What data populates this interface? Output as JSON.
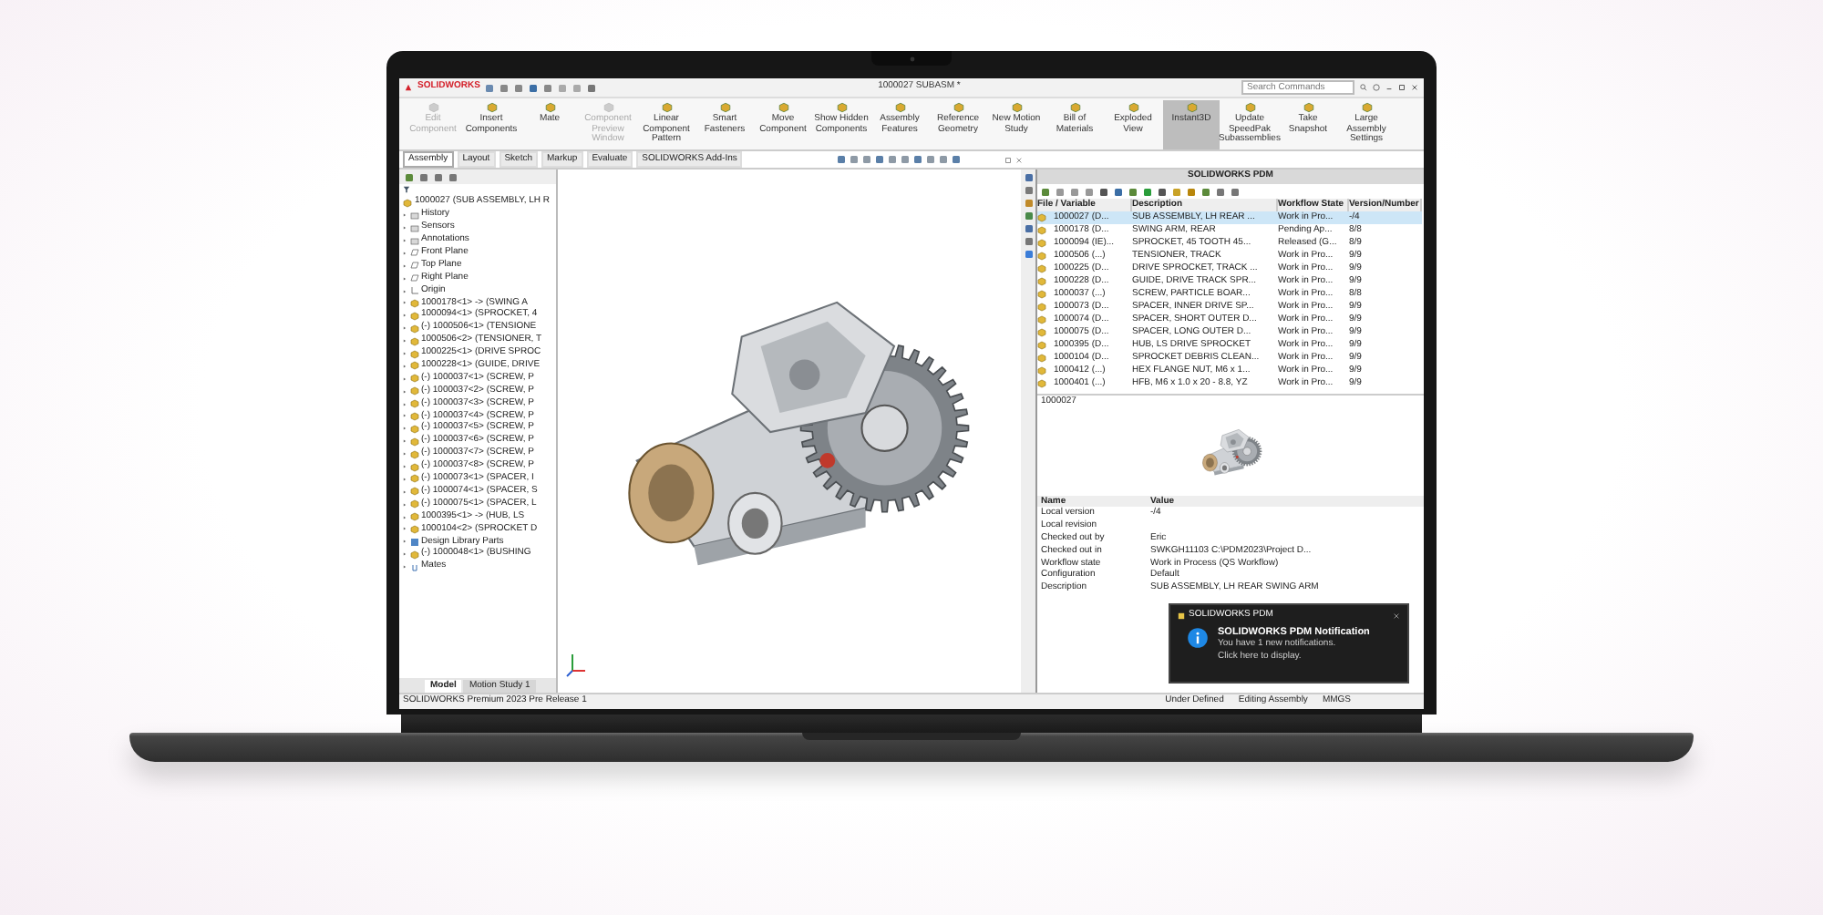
{
  "app": {
    "logo": "SOLIDWORKS",
    "title": "1000027 SUBASM *",
    "search": {
      "placeholder": "Search Commands"
    }
  },
  "ribbon": [
    {
      "label": "Edit Component",
      "disabled": true,
      "selected": false
    },
    {
      "label": "Insert Components",
      "disabled": false,
      "selected": false
    },
    {
      "label": "Mate",
      "disabled": false,
      "selected": false
    },
    {
      "label": "Component Preview Window",
      "disabled": true,
      "selected": false
    },
    {
      "label": "Linear Component Pattern",
      "disabled": false,
      "selected": false
    },
    {
      "label": "Smart Fasteners",
      "disabled": false,
      "selected": false
    },
    {
      "label": "Move Component",
      "disabled": false,
      "selected": false
    },
    {
      "label": "Show Hidden Components",
      "disabled": false,
      "selected": false
    },
    {
      "label": "Assembly Features",
      "disabled": false,
      "selected": false
    },
    {
      "label": "Reference Geometry",
      "disabled": false,
      "selected": false
    },
    {
      "label": "New Motion Study",
      "disabled": false,
      "selected": false
    },
    {
      "label": "Bill of Materials",
      "disabled": false,
      "selected": false
    },
    {
      "label": "Exploded View",
      "disabled": false,
      "selected": false
    },
    {
      "label": "Instant3D",
      "disabled": false,
      "selected": true
    },
    {
      "label": "Update SpeedPak Subassemblies",
      "disabled": false,
      "selected": false
    },
    {
      "label": "Take Snapshot",
      "disabled": false,
      "selected": false
    },
    {
      "label": "Large Assembly Settings",
      "disabled": false,
      "selected": false
    }
  ],
  "tabs": [
    {
      "label": "Assembly",
      "selected": true
    },
    {
      "label": "Layout",
      "selected": false
    },
    {
      "label": "Sketch",
      "selected": false
    },
    {
      "label": "Markup",
      "selected": false
    },
    {
      "label": "Evaluate",
      "selected": false
    },
    {
      "label": "SOLIDWORKS Add-Ins",
      "selected": false
    }
  ],
  "tree": {
    "root": "1000027 (SUB ASSEMBLY, LH R",
    "items": [
      {
        "kind": "folder",
        "label": "History"
      },
      {
        "kind": "folder",
        "label": "Sensors"
      },
      {
        "kind": "folder",
        "label": "Annotations"
      },
      {
        "kind": "plane",
        "label": "Front Plane"
      },
      {
        "kind": "plane",
        "label": "Top Plane"
      },
      {
        "kind": "plane",
        "label": "Right Plane"
      },
      {
        "kind": "origin",
        "label": "Origin"
      },
      {
        "kind": "component",
        "label": "1000178<1> -> (SWING A"
      },
      {
        "kind": "component",
        "label": "1000094<1> (SPROCKET, 4"
      },
      {
        "kind": "component",
        "label": "(-) 1000506<1> (TENSIONE"
      },
      {
        "kind": "component",
        "label": "1000506<2> (TENSIONER, T"
      },
      {
        "kind": "component",
        "label": "1000225<1> (DRIVE SPROC"
      },
      {
        "kind": "component",
        "label": "1000228<1> (GUIDE, DRIVE"
      },
      {
        "kind": "component",
        "label": "(-) 1000037<1> (SCREW, P"
      },
      {
        "kind": "component",
        "label": "(-) 1000037<2> (SCREW, P"
      },
      {
        "kind": "component",
        "label": "(-) 1000037<3> (SCREW, P"
      },
      {
        "kind": "component",
        "label": "(-) 1000037<4> (SCREW, P"
      },
      {
        "kind": "component",
        "label": "(-) 1000037<5> (SCREW, P"
      },
      {
        "kind": "component",
        "label": "(-) 1000037<6> (SCREW, P"
      },
      {
        "kind": "component",
        "label": "(-) 1000037<7> (SCREW, P"
      },
      {
        "kind": "component",
        "label": "(-) 1000037<8> (SCREW, P"
      },
      {
        "kind": "component",
        "label": "(-) 1000073<1> (SPACER, I"
      },
      {
        "kind": "component",
        "label": "(-) 1000074<1> (SPACER, S"
      },
      {
        "kind": "component",
        "label": "(-) 1000075<1> (SPACER, L"
      },
      {
        "kind": "component",
        "label": "1000395<1> -> (HUB, LS"
      },
      {
        "kind": "component",
        "label": "1000104<2> (SPROCKET D"
      },
      {
        "kind": "library",
        "label": "Design Library Parts"
      },
      {
        "kind": "component",
        "label": "(-) 1000048<1> (BUSHING"
      },
      {
        "kind": "mates",
        "label": "Mates"
      }
    ]
  },
  "bottom_tabs": [
    {
      "label": "Model",
      "selected": true
    },
    {
      "label": "Motion Study 1",
      "selected": false
    }
  ],
  "pdm": {
    "title": "SOLIDWORKS PDM",
    "columns": [
      "File / Variable",
      "Description",
      "Workflow State",
      "Version/Number"
    ],
    "rows": [
      {
        "file": "1000027 (D...",
        "description": "SUB ASSEMBLY, LH REAR ...",
        "state": "Work in Pro...",
        "version": "-/4",
        "selected": true
      },
      {
        "file": "1000178 (D...",
        "description": "SWING ARM, REAR",
        "state": "Pending Ap...",
        "version": "8/8",
        "selected": false
      },
      {
        "file": "1000094 (IE)...",
        "description": "SPROCKET, 45 TOOTH 45...",
        "state": "Released (G...",
        "version": "8/9",
        "selected": false
      },
      {
        "file": "1000506 (...)",
        "description": "TENSIONER, TRACK",
        "state": "Work in Pro...",
        "version": "9/9",
        "selected": false
      },
      {
        "file": "1000225 (D...",
        "description": "DRIVE SPROCKET, TRACK ...",
        "state": "Work in Pro...",
        "version": "9/9",
        "selected": false
      },
      {
        "file": "1000228 (D...",
        "description": "GUIDE, DRIVE TRACK SPR...",
        "state": "Work in Pro...",
        "version": "9/9",
        "selected": false
      },
      {
        "file": "1000037 (...)",
        "description": "SCREW, PARTICLE BOAR...",
        "state": "Work in Pro...",
        "version": "8/8",
        "selected": false
      },
      {
        "file": "1000073 (D...",
        "description": "SPACER, INNER DRIVE SP...",
        "state": "Work in Pro...",
        "version": "9/9",
        "selected": false
      },
      {
        "file": "1000074 (D...",
        "description": "SPACER, SHORT OUTER D...",
        "state": "Work in Pro...",
        "version": "9/9",
        "selected": false
      },
      {
        "file": "1000075 (D...",
        "description": "SPACER, LONG OUTER D...",
        "state": "Work in Pro...",
        "version": "9/9",
        "selected": false
      },
      {
        "file": "1000395 (D...",
        "description": "HUB, LS DRIVE SPROCKET",
        "state": "Work in Pro...",
        "version": "9/9",
        "selected": false
      },
      {
        "file": "1000104 (D...",
        "description": "SPROCKET DEBRIS CLEAN...",
        "state": "Work in Pro...",
        "version": "9/9",
        "selected": false
      },
      {
        "file": "1000412 (...)",
        "description": "HEX FLANGE NUT, M6 x 1...",
        "state": "Work in Pro...",
        "version": "9/9",
        "selected": false
      },
      {
        "file": "1000401 (...)",
        "description": "HFB, M6 x 1.0 x 20 - 8.8, YZ",
        "state": "Work in Pro...",
        "version": "9/9",
        "selected": false
      }
    ],
    "preview_label": "1000027",
    "properties_columns": [
      "Name",
      "Value"
    ],
    "properties": [
      {
        "name": "Local version",
        "value": "-/4"
      },
      {
        "name": "Local revision"
      },
      {
        "name": "Checked out by",
        "value": "Eric"
      },
      {
        "name": "Checked out in",
        "value": "SWKGH11103   C:\\PDM2023\\Project D..."
      },
      {
        "name": "Workflow state",
        "value": "Work in Process (QS Workflow)"
      },
      {
        "name": "Configuration",
        "value": "Default"
      },
      {
        "name": "Description",
        "value": "SUB ASSEMBLY, LH REAR SWING ARM"
      }
    ],
    "notification": {
      "app": "SOLIDWORKS PDM",
      "title": "SOLIDWORKS PDM Notification",
      "lines": [
        "You have 1 new notifications.",
        "Click here to display."
      ]
    }
  },
  "status_bar": {
    "product": "SOLIDWORKS Premium 2023 Pre Release 1",
    "items": [
      "Under Defined",
      "Editing Assembly",
      "MMGS"
    ]
  }
}
